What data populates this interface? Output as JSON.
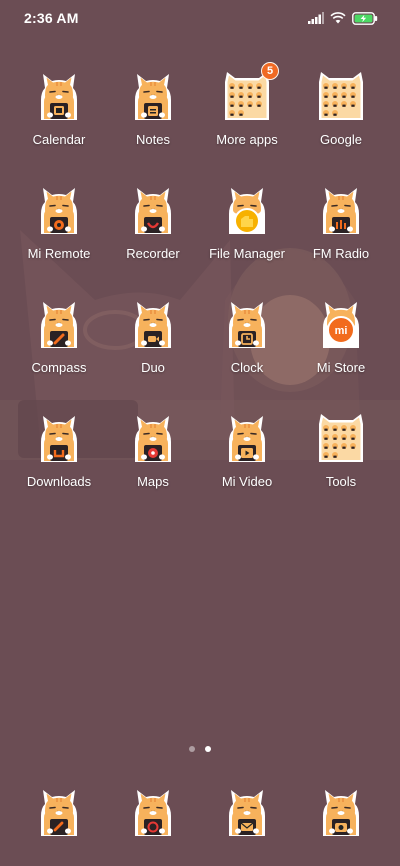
{
  "status_bar": {
    "time": "2:36 AM",
    "icons": [
      "signal-icon",
      "wifi-icon",
      "battery-charging-icon"
    ]
  },
  "apps": [
    {
      "label": "Calendar",
      "icon": "calendar-icon"
    },
    {
      "label": "Notes",
      "icon": "notes-icon"
    },
    {
      "label": "More apps",
      "icon": "folder-icon",
      "badge": "5"
    },
    {
      "label": "Google",
      "icon": "folder-icon"
    },
    {
      "label": "Mi Remote",
      "icon": "mi-remote-icon"
    },
    {
      "label": "Recorder",
      "icon": "recorder-icon"
    },
    {
      "label": "File Manager",
      "icon": "file-manager-icon"
    },
    {
      "label": "FM Radio",
      "icon": "fm-radio-icon"
    },
    {
      "label": "Compass",
      "icon": "compass-icon"
    },
    {
      "label": "Duo",
      "icon": "duo-icon"
    },
    {
      "label": "Clock",
      "icon": "clock-icon"
    },
    {
      "label": "Mi Store",
      "icon": "mi-store-icon"
    },
    {
      "label": "Downloads",
      "icon": "downloads-icon"
    },
    {
      "label": "Maps",
      "icon": "maps-icon"
    },
    {
      "label": "Mi Video",
      "icon": "mi-video-icon"
    },
    {
      "label": "Tools",
      "icon": "folder-icon"
    }
  ],
  "dock": [
    {
      "icon": "phone-icon"
    },
    {
      "icon": "messaging-icon"
    },
    {
      "icon": "browser-icon"
    },
    {
      "icon": "camera-icon"
    }
  ],
  "page_indicator": {
    "count": 2,
    "active": 2
  },
  "colors": {
    "background": "#6b4d54",
    "cat_fur": "#f7b25c",
    "cat_outline": "#ffffff",
    "badge": "#f06a24",
    "mi_orange": "#f26b1d"
  }
}
